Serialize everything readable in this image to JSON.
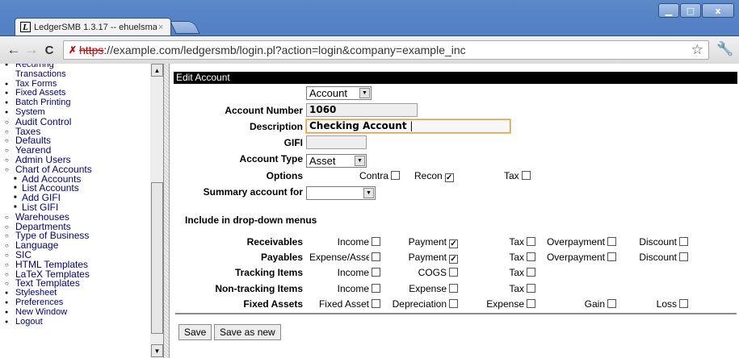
{
  "window": {
    "tab_title": "LedgerSMB 1.3.17 -- ehuelsma",
    "tab_close": "×",
    "favicon_letter": "L",
    "min": "▁",
    "max": "□",
    "close": "x"
  },
  "toolbar": {
    "back": "←",
    "forward": "→",
    "reload": "C",
    "url_scheme": "https",
    "url_rest": "://example.com/ledgersmb/login.pl?action=login&company=example_inc",
    "star": "☆",
    "wrench": "🔧"
  },
  "menu": [
    {
      "label": "Recurring",
      "level": "l1"
    },
    {
      "label": "Transactions",
      "level": "l1c"
    },
    {
      "label": "Tax Forms",
      "level": "l1"
    },
    {
      "label": "Fixed Assets",
      "level": "l1"
    },
    {
      "label": "Batch Printing",
      "level": "l1"
    },
    {
      "label": "System",
      "level": "l1"
    },
    {
      "label": "Audit Control",
      "level": "l2"
    },
    {
      "label": "Taxes",
      "level": "l2"
    },
    {
      "label": "Defaults",
      "level": "l2"
    },
    {
      "label": "Yearend",
      "level": "l2"
    },
    {
      "label": "Admin Users",
      "level": "l2"
    },
    {
      "label": "Chart of Accounts",
      "level": "l2"
    },
    {
      "label": "Add Accounts",
      "level": "l3"
    },
    {
      "label": "List Accounts",
      "level": "l3"
    },
    {
      "label": "Add GIFI",
      "level": "l3"
    },
    {
      "label": "List GIFI",
      "level": "l3"
    },
    {
      "label": "Warehouses",
      "level": "l2"
    },
    {
      "label": "Departments",
      "level": "l2"
    },
    {
      "label": "Type of Business",
      "level": "l2"
    },
    {
      "label": "Language",
      "level": "l2"
    },
    {
      "label": "SIC",
      "level": "l2"
    },
    {
      "label": "HTML Templates",
      "level": "l2"
    },
    {
      "label": "LaTeX Templates",
      "level": "l2"
    },
    {
      "label": "Text Templates",
      "level": "l2"
    },
    {
      "label": "Stylesheet",
      "level": "l1"
    },
    {
      "label": "Preferences",
      "level": "l1"
    },
    {
      "label": "New Window",
      "level": "l1"
    },
    {
      "label": "Logout",
      "level": "l1"
    }
  ],
  "form": {
    "heading": "Edit Account",
    "charttype_value": "Account",
    "account_number_label": "Account Number",
    "account_number_value": "1060",
    "description_label": "Description",
    "description_value": "Checking Account",
    "gifi_label": "GIFI",
    "gifi_value": "",
    "account_type_label": "Account Type",
    "account_type_value": "Asset",
    "options_label": "Options",
    "contra_label": "Contra",
    "recon_label": "Recon",
    "tax_label": "Tax",
    "summary_label": "Summary account for",
    "summary_value": "",
    "include_heading": "Include in drop-down menus",
    "rows": [
      {
        "label": "Receivables",
        "cells": [
          {
            "text": "Income",
            "checked": false
          },
          {
            "text": "Payment",
            "checked": true
          },
          {
            "text": "Tax",
            "checked": false
          },
          {
            "text": "Overpayment",
            "checked": false
          },
          {
            "text": "Discount",
            "checked": false
          }
        ]
      },
      {
        "label": "Payables",
        "cells": [
          {
            "text": "Expense/Asset",
            "checked": false
          },
          {
            "text": "Payment",
            "checked": true
          },
          {
            "text": "Tax",
            "checked": false
          },
          {
            "text": "Overpayment",
            "checked": false
          },
          {
            "text": "Discount",
            "checked": false
          }
        ]
      },
      {
        "label": "Tracking Items",
        "cells": [
          {
            "text": "Income",
            "checked": false
          },
          {
            "text": "COGS",
            "checked": false
          },
          {
            "text": "Tax",
            "checked": false
          }
        ]
      },
      {
        "label": "Non-tracking Items",
        "cells": [
          {
            "text": "Income",
            "checked": false
          },
          {
            "text": "Expense",
            "checked": false
          },
          {
            "text": "Tax",
            "checked": false
          }
        ]
      },
      {
        "label": "Fixed Assets",
        "cells": [
          {
            "text": "Fixed Asset",
            "checked": false
          },
          {
            "text": "Depreciation",
            "checked": false
          },
          {
            "text": "Expense",
            "checked": false
          },
          {
            "text": "Gain",
            "checked": false
          },
          {
            "text": "Loss",
            "checked": false
          }
        ]
      }
    ],
    "save_label": "Save",
    "save_as_new_label": "Save as new"
  }
}
